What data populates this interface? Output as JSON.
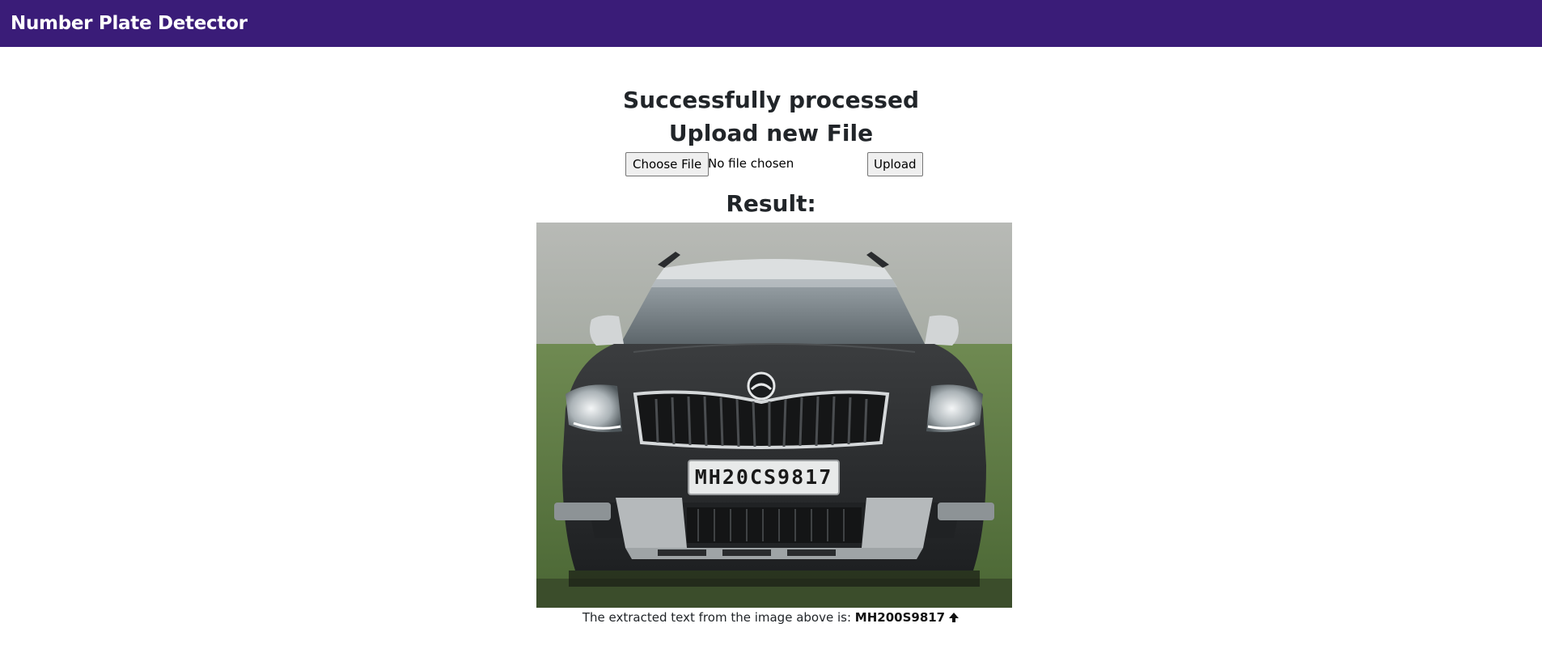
{
  "navbar": {
    "brand": "Number Plate Detector",
    "background": "#3a1c78"
  },
  "main": {
    "status_heading": "Successfully processed",
    "upload_heading": "Upload new File",
    "file_input": {
      "button_label": "Choose File",
      "status_text": "No file chosen"
    },
    "upload_button_label": "Upload",
    "result_heading": "Result:",
    "result_image": {
      "plate_text": "MH20CS9817"
    },
    "caption": {
      "prefix": "The extracted text from the image above is:",
      "extracted_text": "MH200S9817",
      "icon": "arrow-up-icon"
    }
  }
}
